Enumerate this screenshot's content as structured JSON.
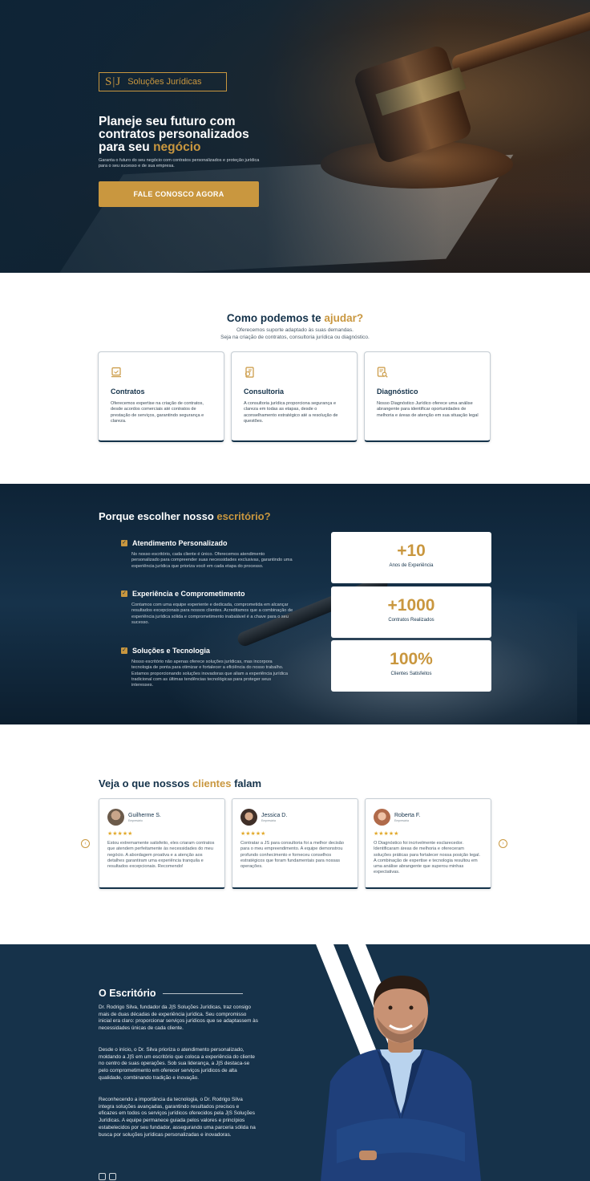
{
  "hero": {
    "logo_mark": "S|J",
    "logo_text": "Soluções Jurídicas",
    "title_line1": "Planeje seu futuro com",
    "title_line2": "contratos personalizados",
    "title_line3_prefix": "para seu ",
    "title_line3_highlight": "negócio",
    "subtitle": "Garanta o futuro do seu negócio com contratos personalizados e proteção jurídica para o seu sucesso e de sua empresa.",
    "cta_label": "FALE CONOSCO AGORA"
  },
  "services": {
    "title_prefix": "Como podemos te ",
    "title_highlight": "ajudar?",
    "subtitle_line1": "Oferecemos suporte adaptado às suas demandas.",
    "subtitle_line2": "Seja na criação de contratos, consultoria jurídica ou diagnóstico.",
    "cards": [
      {
        "icon": "contract-icon",
        "title": "Contratos",
        "text": "Oferecemos expertise na criação de contratos, desde acordos comerciais até contratos de prestação de serviços, garantindo segurança e clareza."
      },
      {
        "icon": "consulting-icon",
        "title": "Consultoria",
        "text": "A consultoria jurídica proporciona segurança e clareza em todas as etapas, desde o aconselhamento estratégico até a resolução de questões."
      },
      {
        "icon": "diagnosis-icon",
        "title": "Diagnóstico",
        "text": "Nosso Diagnóstico Jurídico oferece uma análise abrangente para identificar oportunidades de melhoria e áreas de atenção em sua situação legal"
      }
    ]
  },
  "why": {
    "title_prefix": "Porque escolher nosso ",
    "title_highlight": "escritório?",
    "items": [
      {
        "title": "Atendimento Personalizado",
        "text": "No nosso escritório, cada cliente é único. Oferecemos atendimento personalizado para compreender suas necessidades exclusivas, garantindo uma experiência jurídica que prioriza você em cada etapa do processo."
      },
      {
        "title": "Experiência e Comprometimento",
        "text": "Contamos com uma equipe experiente e dedicada, comprometida em alcançar resultados excepcionais para nossos clientes. Acreditamos que a combinação de experiência jurídica sólida e comprometimento inabalável é a chave para o seu sucesso."
      },
      {
        "title": "Soluções e Tecnologia",
        "text": "Nosso escritório não apenas oferece soluções jurídicas, mas incorpora tecnologia de ponta para otimizar e fortalecer a eficiência do nosso trabalho. Estamos proporcionando soluções inovadoras que aliam a experiência jurídica tradicional com as últimas tendências tecnológicas para proteger seus interesses."
      }
    ],
    "stats": [
      {
        "value": "+10",
        "label": "Anos de Experiência"
      },
      {
        "value": "+1000",
        "label": "Contratos Realizados"
      },
      {
        "value": "100%",
        "label": "Clientes Satisfeitos"
      }
    ]
  },
  "testimonials": {
    "title_prefix": "Veja o que nossos ",
    "title_highlight": "clientes",
    "title_suffix": " falam",
    "prev_icon": "arrow-left-icon",
    "next_icon": "arrow-right-icon",
    "items": [
      {
        "name": "Guilherme S.",
        "role": "Empresário",
        "stars": "★★★★★",
        "avatar_color": "#6b5a4a",
        "text": "Estou extremamente satisfeito, eles criaram contratos que atendem perfeitamente às necessidades do meu negócio. A abordagem proativa e a atenção aos detalhes garantiram uma experiência tranquila e resultados excepcionais. Recomendo!"
      },
      {
        "name": "Jessica D.",
        "role": "Empresária",
        "stars": "★★★★★",
        "avatar_color": "#3f2f28",
        "text": "Contratar a JS para consultoria foi a melhor decisão para o meu empreendimento. A equipe demonstrou profundo conhecimento e forneceu conselhos estratégicos que foram fundamentais para nossas operações."
      },
      {
        "name": "Roberta F.",
        "role": "Empresária",
        "stars": "★★★★★",
        "avatar_color": "#b06a4a",
        "text": "O Diagnóstico foi incrivelmente esclarecedor. Identificaram áreas de melhoria e ofereceram soluções práticas para fortalecer nossa posição legal. A combinação de expertise e tecnologia resultou em uma análise abrangente que superou minhas expectativas."
      }
    ]
  },
  "about": {
    "title": "O Escritório",
    "p1": "Dr. Rodrigo Silva, fundador da J|S Soluções Jurídicas, traz consigo mais de duas décadas de experiência jurídica. Seu compromisso inicial era claro: proporcionar serviços jurídicos que se adaptassem às necessidades únicas de cada cliente.",
    "p2": "Desde o início, o Dr. Silva prioriza o atendimento personalizado, moldando a J|S em um escritório que coloca a experiência do cliente no centro de suas operações. Sob sua liderança, a J|S destaca-se pelo comprometimento em oferecer serviços jurídicos de alta qualidade, combinando tradição e inovação.",
    "p3": "Reconhecendo a importância da tecnologia, o Dr. Rodrigo Silva integra soluções avançadas, garantindo resultados precisos e eficazes em todos os serviços jurídicos oferecidos pela J|S Soluções Jurídicas. A equipe permanece guiada pelos valores e princípios estabelecidos por seu fundador, assegurando uma parceria sólida na busca por soluções jurídicas personalizadas e inovadoras.",
    "social": [
      "instagram-icon",
      "facebook-icon"
    ]
  },
  "colors": {
    "navy": "#14324a",
    "gold": "#c9973f"
  }
}
